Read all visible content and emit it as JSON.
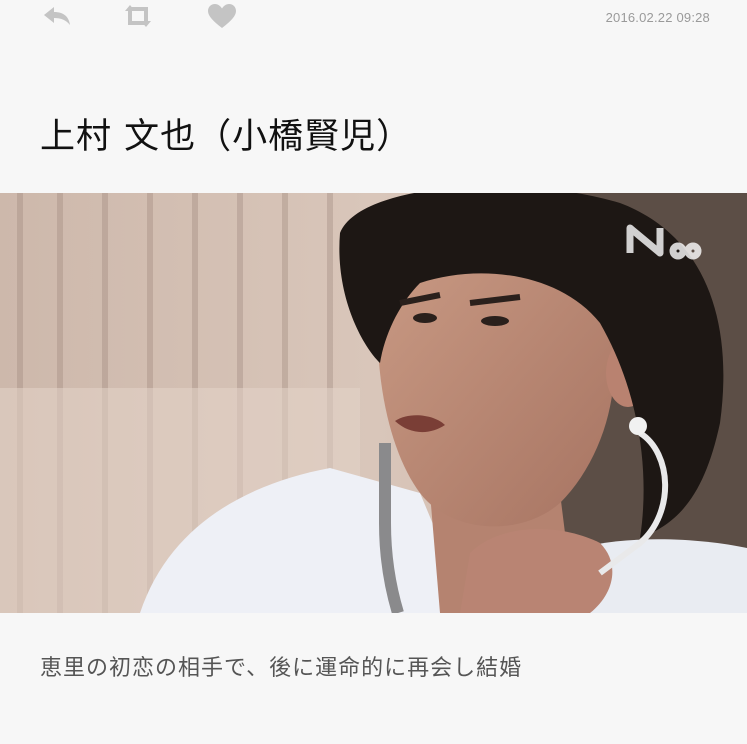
{
  "toolbar": {
    "icons": [
      "reply-icon",
      "retweet-icon",
      "heart-icon"
    ],
    "icon_color": "#c4c4c4"
  },
  "post": {
    "timestamp": "2016.02.22 09:28",
    "title": "上村 文也（小橋賢児）",
    "caption": "恵里の初恋の相手で、後に運命的に再会し結婚"
  },
  "image": {
    "watermark_text": "N∞"
  }
}
